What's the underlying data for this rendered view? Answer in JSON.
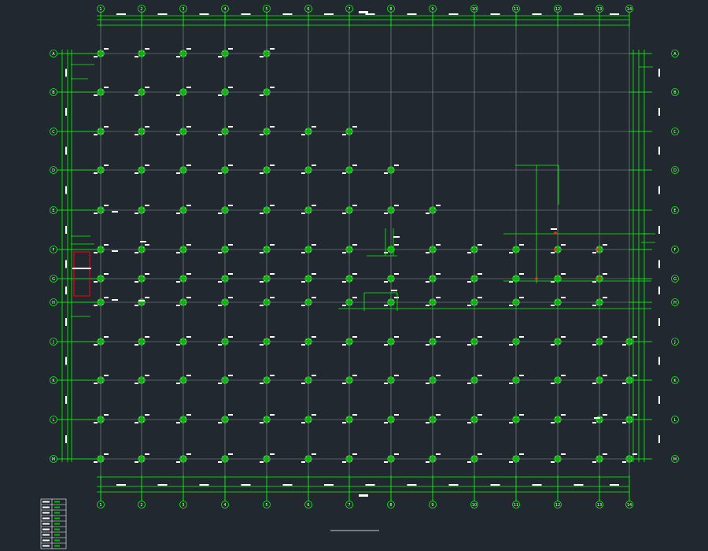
{
  "drawing": {
    "title": "",
    "scale": ""
  },
  "grid": {
    "columns": [
      "1",
      "2",
      "3",
      "4",
      "5",
      "6",
      "7",
      "8",
      "9",
      "10",
      "11",
      "12",
      "13",
      "14"
    ],
    "rows": [
      "A",
      "B",
      "C",
      "D",
      "E",
      "F",
      "G",
      "H",
      "J",
      "K",
      "L",
      "M"
    ]
  },
  "colors": {
    "background": "#212830",
    "grid_line": "#8c939c",
    "dimension_line": "#00ff00",
    "column_mark": "#00c000",
    "annotation": "#ffffff",
    "highlight_box": "#ff0000",
    "accent": "#ff3300"
  },
  "legend_table": {
    "rows": 9
  }
}
